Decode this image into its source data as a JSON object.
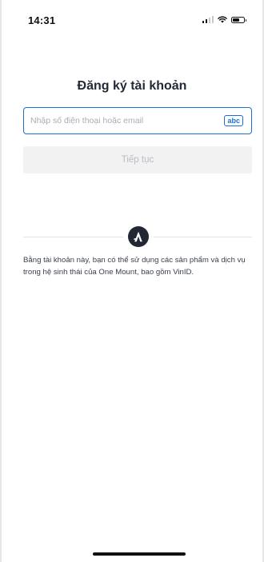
{
  "status_bar": {
    "time": "14:31"
  },
  "page": {
    "title": "Đăng ký tài khoản"
  },
  "phone_email_input": {
    "value": "",
    "placeholder": "Nhập số điện thoại hoặc email",
    "keyboard_hint": "abc"
  },
  "continue_button": {
    "label": "Tiếp tục",
    "enabled": false
  },
  "brand": {
    "logo_icon": "one-mount-logo-icon"
  },
  "terms": {
    "text": "Bằng tài khoản này, bạn có thể sử dụng các sản phẩm và dịch vụ trong hệ sinh thái của One Mount, bao gồm VinID."
  },
  "colors": {
    "accent": "#1a6fd0",
    "title": "#232a36",
    "button_disabled_bg": "#f2f2f3",
    "button_disabled_text": "#b9bcc2",
    "logo_bg": "#222833"
  }
}
